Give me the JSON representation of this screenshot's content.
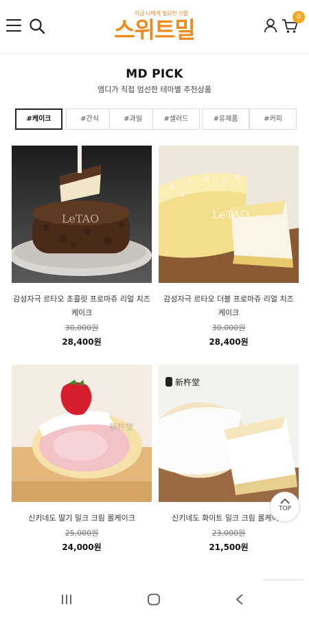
{
  "header": {
    "menu_icon": "hamburger-menu-icon",
    "search_icon": "search-icon",
    "logo_tagline": "지금 나에게 필요한 선물",
    "logo_text": "스위트밀",
    "user_icon": "user-icon",
    "cart_icon": "cart-icon",
    "cart_count": "0",
    "accent_color": "#ef8a1c"
  },
  "section": {
    "title": "MD PICK",
    "subtitle": "엠디가 직접 엄선한 테마별 추천상품"
  },
  "tabs": [
    {
      "label": "#케이크",
      "active": true
    },
    {
      "label": "#간식",
      "active": false
    },
    {
      "label": "#과일",
      "active": false
    },
    {
      "label": "#샐러드",
      "active": false
    },
    {
      "label": "#유제품",
      "active": false
    },
    {
      "label": "#커피",
      "active": false
    }
  ],
  "products": [
    {
      "name": "감성자극 르타오 초콜릿 프로마쥬 리얼 치즈 케이크",
      "original_price": "30,000원",
      "price": "28,400원",
      "image_watermark": "LeTAO"
    },
    {
      "name": "감성자극 르타오 더블 프로마쥬 리얼 치즈 케이크",
      "original_price": "30,000원",
      "price": "28,400원",
      "image_watermark": "LeTAO"
    },
    {
      "name": "신키네도 딸기 밀크 크림 롤케이크",
      "original_price": "25,000원",
      "price": "24,000원",
      "image_watermark": "新杵堂"
    },
    {
      "name": "신키네도 화이트 밀크 크림 롤케이크",
      "original_price": "23,000원",
      "price": "21,500원",
      "image_watermark": "新杵堂"
    }
  ],
  "top_button": {
    "label": "TOP",
    "icon": "chevron-up-icon"
  },
  "system_nav": {
    "recents_icon": "recents-icon",
    "home_icon": "home-icon",
    "back_icon": "back-icon"
  }
}
